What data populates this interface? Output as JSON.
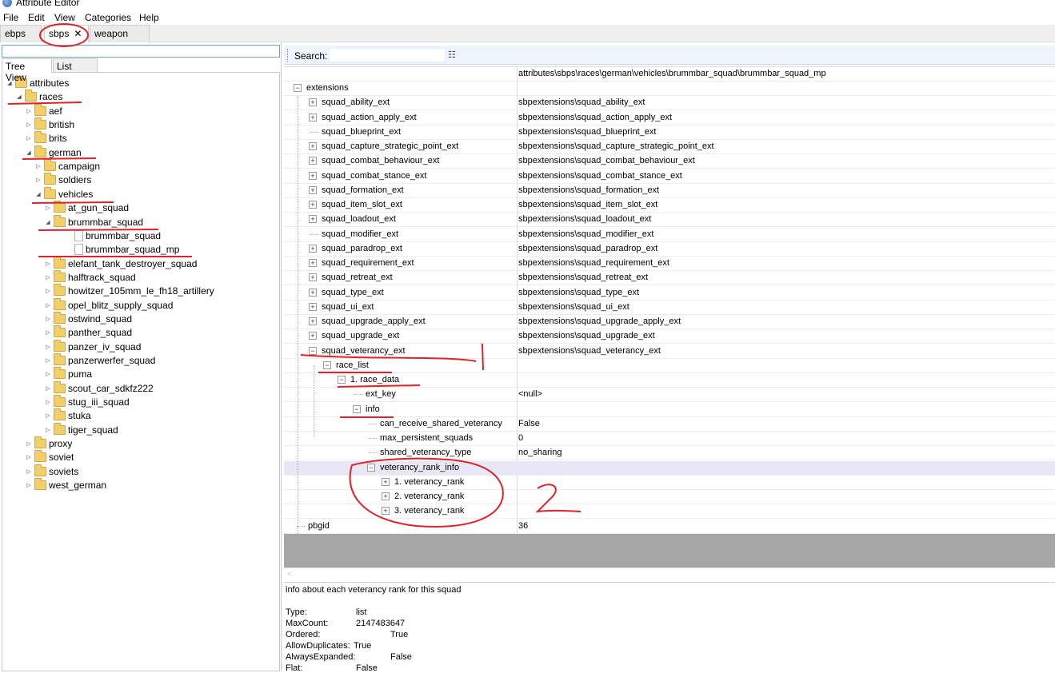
{
  "window": {
    "title": "Attribute Editor"
  },
  "menu": [
    "File",
    "Edit",
    "View",
    "Categories",
    "Help"
  ],
  "doc_tabs": [
    {
      "label": "ebps"
    },
    {
      "label": "sbps",
      "close": "✕"
    },
    {
      "label": "weapon"
    }
  ],
  "left_panel": {
    "view_tabs": [
      "Tree View",
      "List View"
    ],
    "tree": [
      {
        "label": "attributes"
      },
      {
        "label": "races"
      },
      {
        "label": "aef"
      },
      {
        "label": "british"
      },
      {
        "label": "brits"
      },
      {
        "label": "german"
      },
      {
        "label": "campaign"
      },
      {
        "label": "soldiers"
      },
      {
        "label": "vehicles"
      },
      {
        "label": "at_gun_squad"
      },
      {
        "label": "brummbar_squad"
      },
      {
        "label": "brummbar_squad"
      },
      {
        "label": "brummbar_squad_mp"
      },
      {
        "label": "elefant_tank_destroyer_squad"
      },
      {
        "label": "halftrack_squad"
      },
      {
        "label": "howitzer_105mm_le_fh18_artillery"
      },
      {
        "label": "opel_blitz_supply_squad"
      },
      {
        "label": "ostwind_squad"
      },
      {
        "label": "panther_squad"
      },
      {
        "label": "panzer_iv_squad"
      },
      {
        "label": "panzerwerfer_squad"
      },
      {
        "label": "puma"
      },
      {
        "label": "scout_car_sdkfz222"
      },
      {
        "label": "stug_iii_squad"
      },
      {
        "label": "stuka"
      },
      {
        "label": "tiger_squad"
      },
      {
        "label": "proxy"
      },
      {
        "label": "soviet"
      },
      {
        "label": "soviets"
      },
      {
        "label": "west_german"
      }
    ]
  },
  "right_panel": {
    "search_label": "Search:",
    "search_value": "",
    "path_header": "attributes\\sbps\\races\\german\\vehicles\\brummbar_squad\\brummbar_squad_mp",
    "rows": [
      {
        "name": "extensions",
        "value": ""
      },
      {
        "name": "squad_ability_ext",
        "value": "sbpextensions\\squad_ability_ext"
      },
      {
        "name": "squad_action_apply_ext",
        "value": "sbpextensions\\squad_action_apply_ext"
      },
      {
        "name": "squad_blueprint_ext",
        "value": "sbpextensions\\squad_blueprint_ext"
      },
      {
        "name": "squad_capture_strategic_point_ext",
        "value": "sbpextensions\\squad_capture_strategic_point_ext"
      },
      {
        "name": "squad_combat_behaviour_ext",
        "value": "sbpextensions\\squad_combat_behaviour_ext"
      },
      {
        "name": "squad_combat_stance_ext",
        "value": "sbpextensions\\squad_combat_stance_ext"
      },
      {
        "name": "squad_formation_ext",
        "value": "sbpextensions\\squad_formation_ext"
      },
      {
        "name": "squad_item_slot_ext",
        "value": "sbpextensions\\squad_item_slot_ext"
      },
      {
        "name": "squad_loadout_ext",
        "value": "sbpextensions\\squad_loadout_ext"
      },
      {
        "name": "squad_modifier_ext",
        "value": "sbpextensions\\squad_modifier_ext"
      },
      {
        "name": "squad_paradrop_ext",
        "value": "sbpextensions\\squad_paradrop_ext"
      },
      {
        "name": "squad_requirement_ext",
        "value": "sbpextensions\\squad_requirement_ext"
      },
      {
        "name": "squad_retreat_ext",
        "value": "sbpextensions\\squad_retreat_ext"
      },
      {
        "name": "squad_type_ext",
        "value": "sbpextensions\\squad_type_ext"
      },
      {
        "name": "squad_ui_ext",
        "value": "sbpextensions\\squad_ui_ext"
      },
      {
        "name": "squad_upgrade_apply_ext",
        "value": "sbpextensions\\squad_upgrade_apply_ext"
      },
      {
        "name": "squad_upgrade_ext",
        "value": "sbpextensions\\squad_upgrade_ext"
      },
      {
        "name": "squad_veterancy_ext",
        "value": "sbpextensions\\squad_veterancy_ext"
      },
      {
        "name": "race_list",
        "value": ""
      },
      {
        "name": "1. race_data",
        "value": ""
      },
      {
        "name": "ext_key",
        "value": "<null>"
      },
      {
        "name": "info",
        "value": ""
      },
      {
        "name": "can_receive_shared_veterancy",
        "value": "False"
      },
      {
        "name": "max_persistent_squads",
        "value": "0"
      },
      {
        "name": "shared_veterancy_type",
        "value": "no_sharing"
      },
      {
        "name": "veterancy_rank_info",
        "value": ""
      },
      {
        "name": "1. veterancy_rank",
        "value": ""
      },
      {
        "name": "2. veterancy_rank",
        "value": ""
      },
      {
        "name": "3. veterancy_rank",
        "value": ""
      },
      {
        "name": "pbgid",
        "value": "36"
      }
    ],
    "description": {
      "text": "info about each veterancy rank for this squad",
      "props": [
        {
          "key": "Type:",
          "value": "list"
        },
        {
          "key": "MaxCount:",
          "value": "2147483647"
        },
        {
          "key": "Ordered:",
          "value": "True"
        },
        {
          "key": "AllowDuplicates:",
          "value": "True"
        },
        {
          "key": "AlwaysExpanded:",
          "value": "False"
        },
        {
          "key": "Flat:",
          "value": "False"
        }
      ]
    }
  },
  "annotations": {
    "mark1": "1",
    "mark2": "2",
    "color": "#e0222a"
  }
}
